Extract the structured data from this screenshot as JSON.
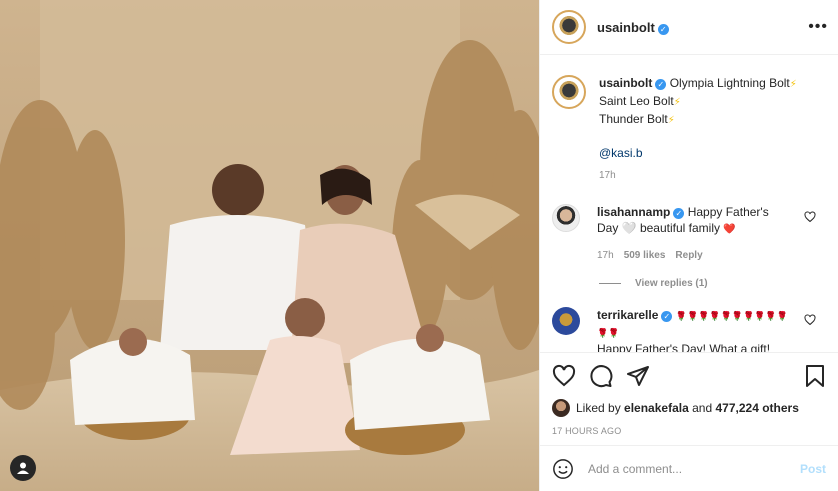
{
  "photo": {
    "description_icon": "user-tag-icon"
  },
  "header": {
    "username": "usainbolt",
    "more_icon": "more-options-icon",
    "more_label": "•••"
  },
  "caption": {
    "username": "usainbolt",
    "line1": "Olympia Lightning Bolt",
    "line2": "Saint Leo Bolt",
    "line3": "Thunder Bolt",
    "bolt": "⚡",
    "mention": "@kasi.b",
    "time": "17h"
  },
  "comments": [
    {
      "username": "lisahannamp",
      "text": "Happy Father's Day 🤍 beautiful family",
      "heart_emoji": "❤️",
      "time": "17h",
      "likes": "509 likes",
      "reply": "Reply",
      "view_replies": "View replies (1)"
    },
    {
      "username": "terrikarelle",
      "line1": "🌹🌹🌹🌹🌹🌹🌹🌹🌹🌹🌹🌹",
      "line2": "Happy Father's Day! What a gift!"
    }
  ],
  "actions": {
    "liked_prefix": "Liked by",
    "liked_user": "elenakefala",
    "liked_and": "and",
    "liked_count": "477,224 others",
    "posted_time": "17 HOURS AGO"
  },
  "add_comment": {
    "placeholder": "Add a comment...",
    "post_label": "Post"
  },
  "colors": {
    "verified": "#3897f0",
    "link": "#00376b",
    "post_disabled": "#b2dffc"
  }
}
